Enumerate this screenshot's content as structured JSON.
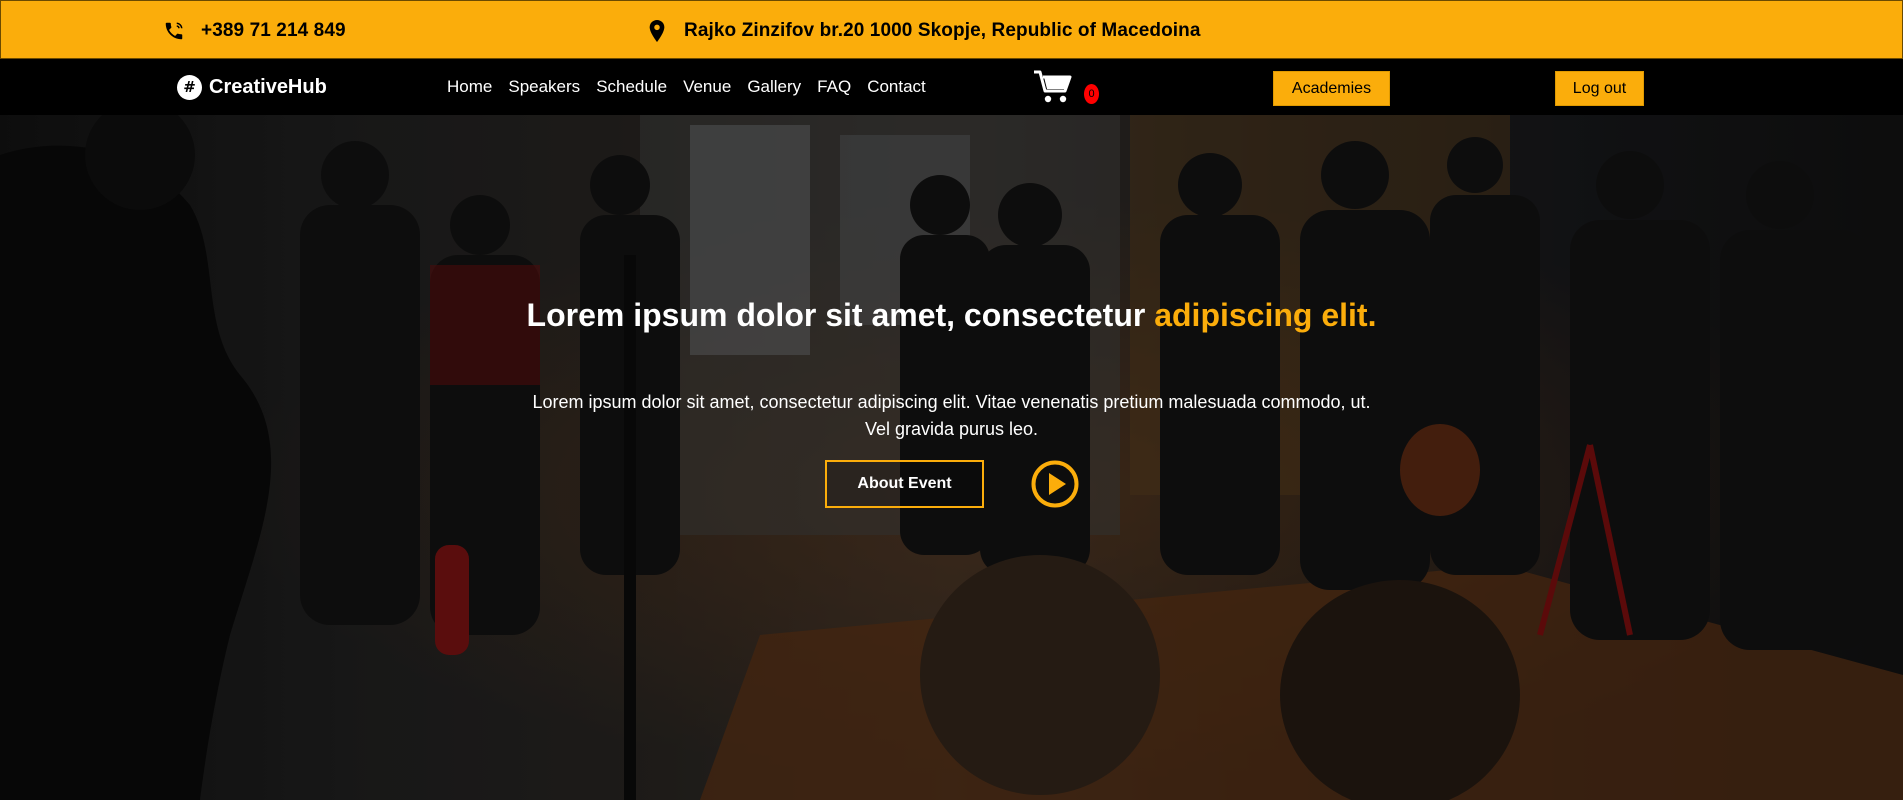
{
  "topbar": {
    "phone": "+389 71 214 849",
    "address": "Rajko Zinzifov br.20 1000 Skopje, Republic of Macedoina",
    "phone_icon": "phone-icon",
    "address_icon": "map-pin-icon",
    "background": "#FBAD0B"
  },
  "nav": {
    "brand": "CreativeHub",
    "brand_icon": "hashtag-logo-icon",
    "links": [
      "Home",
      "Speakers",
      "Schedule",
      "Venue",
      "Gallery",
      "FAQ",
      "Contact"
    ],
    "cart_icon": "shopping-cart-icon",
    "cart_count": "0",
    "academies_label": "Academies",
    "logout_label": "Log out",
    "accent": "#FBAD0B"
  },
  "hero": {
    "title_main": "Lorem ipsum dolor sit amet, consectetur",
    "title_accent": "adipiscing elit.",
    "subtitle": "Lorem ipsum dolor sit amet, consectetur adipiscing elit. Vitae venenatis pretium malesuada commodo, ut. Vel gravida purus leo.",
    "about_label": "About Event",
    "play_icon": "play-circle-icon"
  }
}
